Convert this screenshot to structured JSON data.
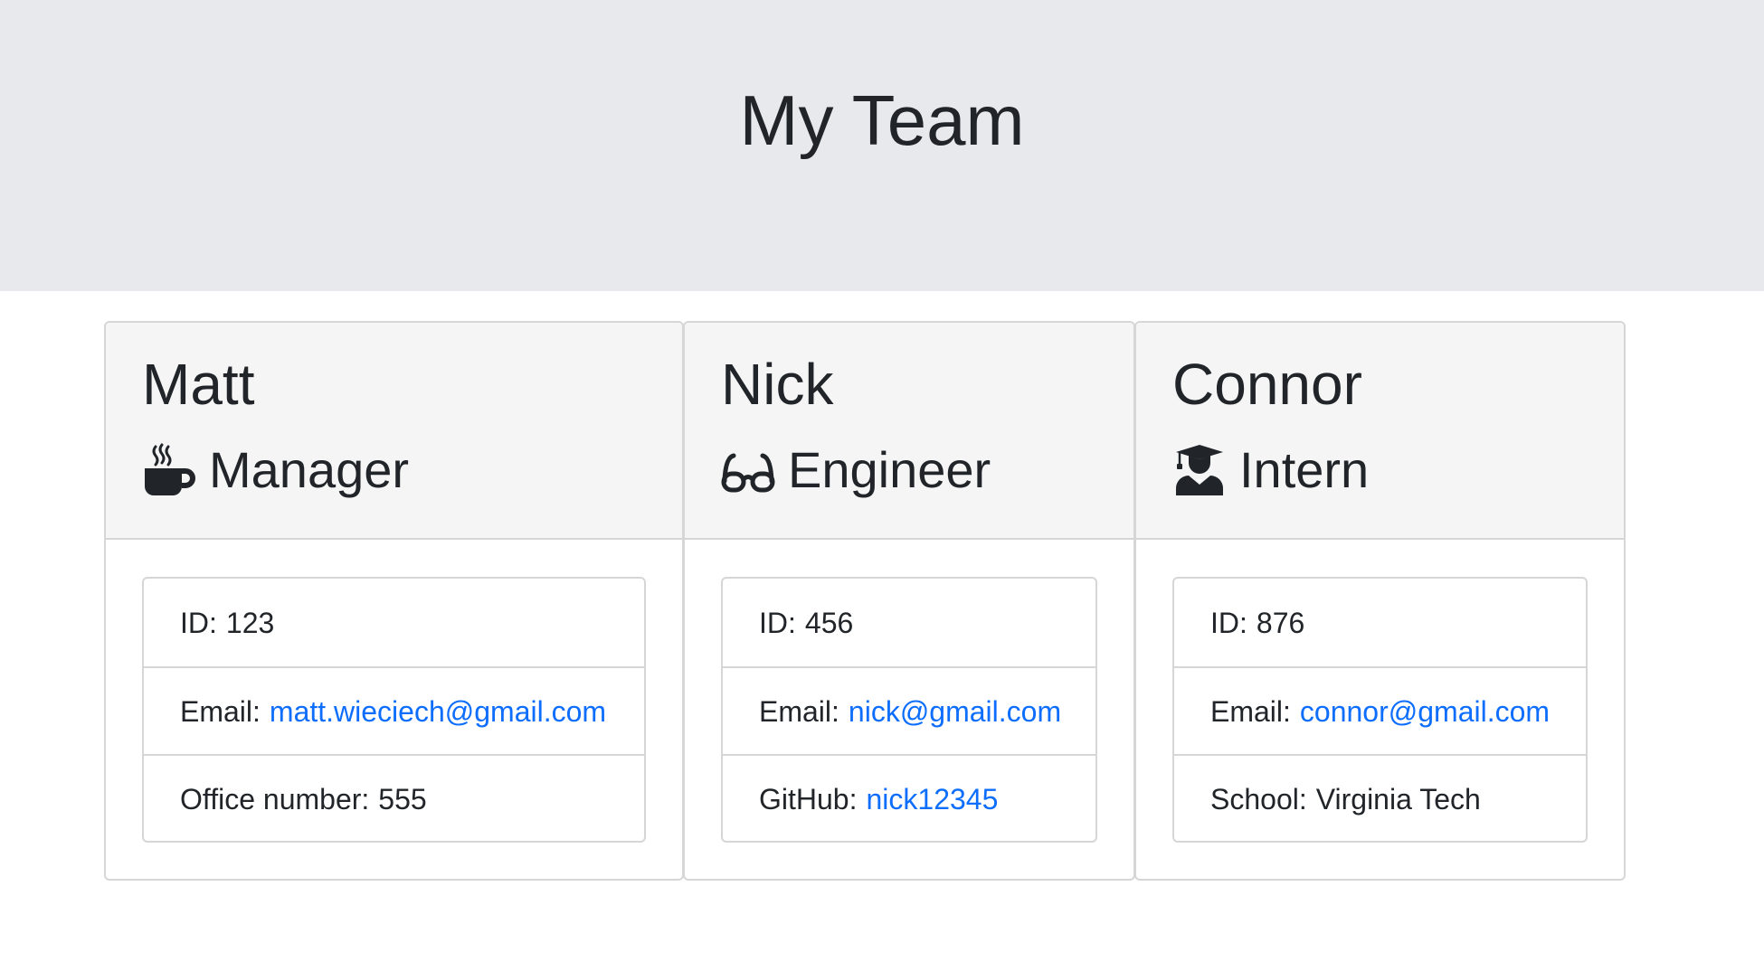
{
  "header": {
    "title": "My Team"
  },
  "cards": [
    {
      "name": "Matt",
      "role": "Manager",
      "icon": "mug-hot-icon",
      "id_label": "ID:",
      "id_value": "123",
      "email_label": "Email:",
      "email_value": "matt.wieciech@gmail.com",
      "extra_label": "Office number:",
      "extra_value": "555"
    },
    {
      "name": "Nick",
      "role": "Engineer",
      "icon": "glasses-icon",
      "id_label": "ID:",
      "id_value": "456",
      "email_label": "Email:",
      "email_value": "nick@gmail.com",
      "extra_label": "GitHub:",
      "extra_value": "nick12345"
    },
    {
      "name": "Connor",
      "role": "Intern",
      "icon": "user-graduate-icon",
      "id_label": "ID:",
      "id_value": "876",
      "email_label": "Email:",
      "email_value": "connor@gmail.com",
      "extra_label": "School:",
      "extra_value": "Virginia Tech"
    }
  ],
  "colors": {
    "header_bg": "#e7e9ed",
    "card_header_bg": "#f5f5f5",
    "border": "#d6d6d6",
    "link": "#0d6efd",
    "text": "#212529"
  }
}
